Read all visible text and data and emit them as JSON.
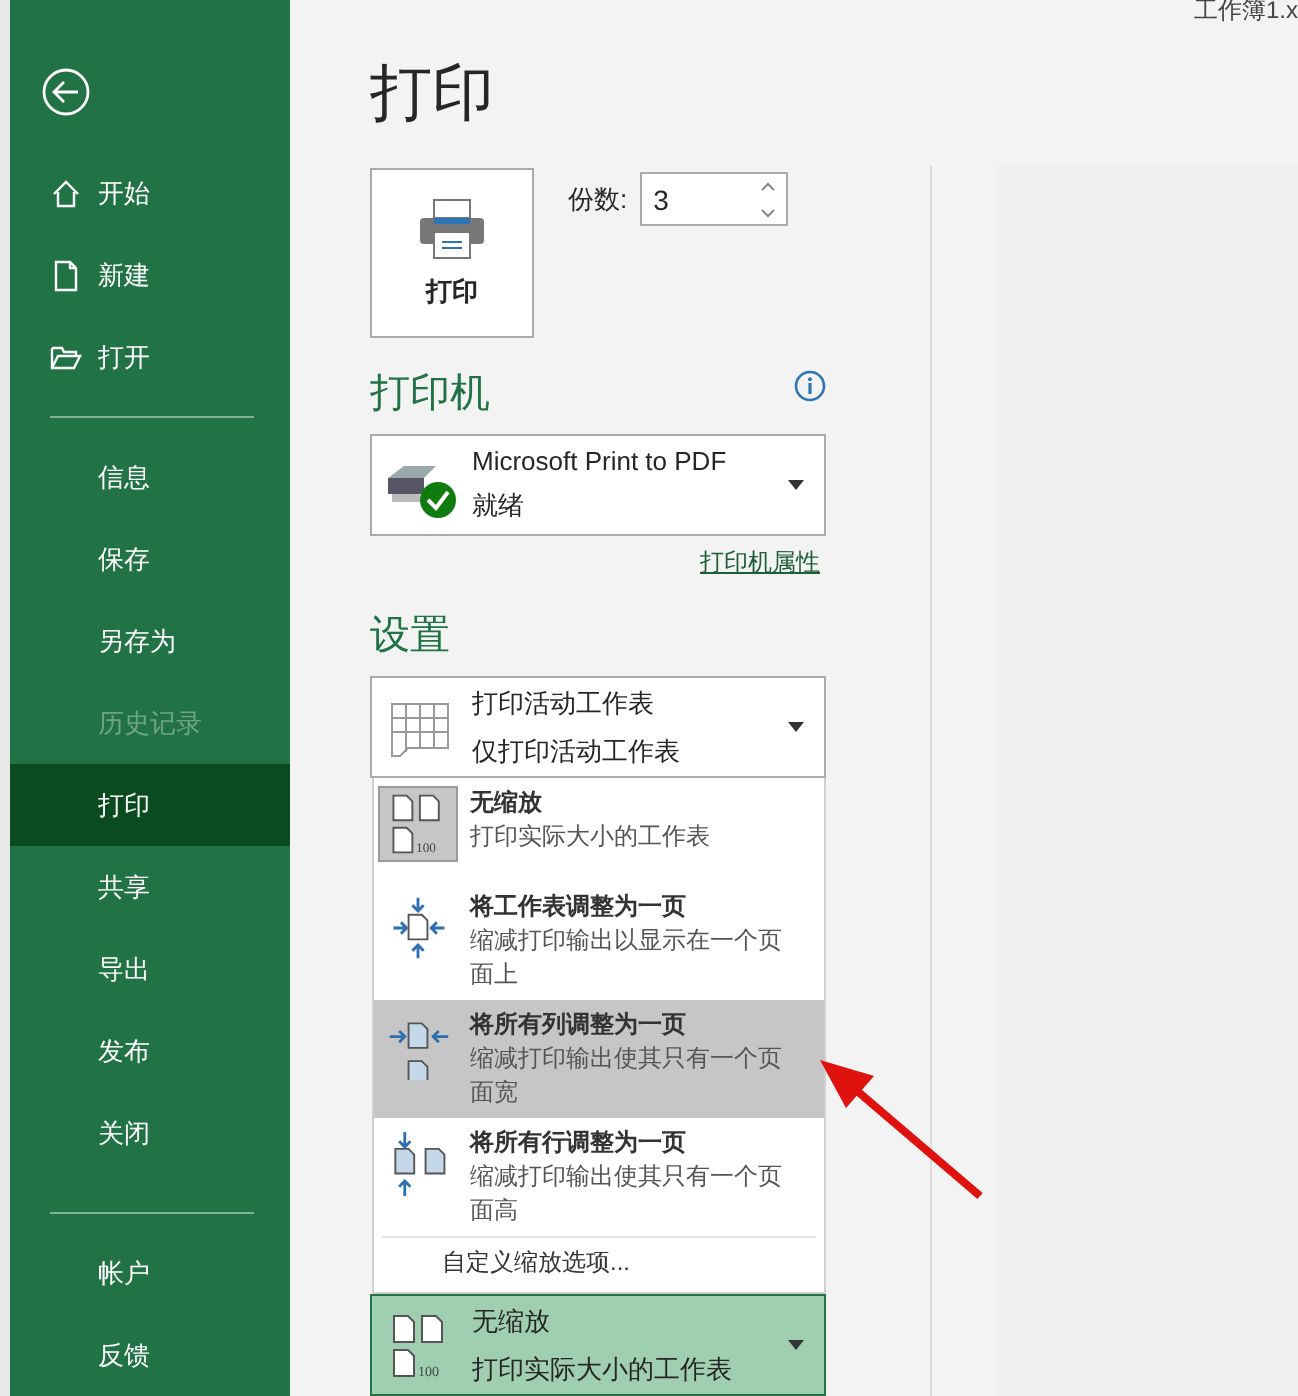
{
  "window": {
    "title": "工作簿1.x"
  },
  "sidebar": {
    "groups": [
      [
        {
          "label": "开始",
          "selected": false,
          "disabled": false
        },
        {
          "label": "新建",
          "selected": false,
          "disabled": false
        },
        {
          "label": "打开",
          "selected": false,
          "disabled": false
        }
      ],
      [
        {
          "label": "信息",
          "selected": false,
          "disabled": false
        },
        {
          "label": "保存",
          "selected": false,
          "disabled": false
        },
        {
          "label": "另存为",
          "selected": false,
          "disabled": false
        },
        {
          "label": "历史记录",
          "selected": false,
          "disabled": true
        },
        {
          "label": "打印",
          "selected": true,
          "disabled": false
        },
        {
          "label": "共享",
          "selected": false,
          "disabled": false
        },
        {
          "label": "导出",
          "selected": false,
          "disabled": false
        },
        {
          "label": "发布",
          "selected": false,
          "disabled": false
        },
        {
          "label": "关闭",
          "selected": false,
          "disabled": false
        }
      ],
      [
        {
          "label": "帐户",
          "selected": false,
          "disabled": false
        },
        {
          "label": "反馈",
          "selected": false,
          "disabled": false
        }
      ]
    ]
  },
  "page_title": "打印",
  "print_button": {
    "label": "打印"
  },
  "copies": {
    "label": "份数:",
    "value": "3"
  },
  "printer": {
    "heading": "打印机",
    "name": "Microsoft Print to PDF",
    "status": "就绪",
    "ready": true,
    "properties_link": "打印机属性"
  },
  "settings": {
    "heading": "设置",
    "dropdowns": [
      {
        "kind": "sheet",
        "title": "打印活动工作表",
        "subtitle": "仅打印活动工作表",
        "open": false
      },
      {
        "kind": "no-scaling",
        "icon_text": "100",
        "title": "无缩放",
        "subtitle": "打印实际大小的工作表",
        "open": true
      }
    ],
    "scaling_menu": {
      "items": [
        {
          "kind": "no-scaling",
          "icon_text": "100",
          "title": "无缩放",
          "description": "打印实际大小的工作表",
          "selected": true,
          "highlighted": false
        },
        {
          "kind": "fit-sheet",
          "title": "将工作表调整为一页",
          "description": "缩减打印输出以显示在一个页面上",
          "selected": false,
          "highlighted": false
        },
        {
          "kind": "fit-columns",
          "title": "将所有列调整为一页",
          "description": "缩减打印输出使其只有一个页面宽",
          "selected": false,
          "highlighted": true
        },
        {
          "kind": "fit-rows",
          "title": "将所有行调整为一页",
          "description": "缩减打印输出使其只有一个页面高",
          "selected": false,
          "highlighted": false
        }
      ],
      "footer": "自定义缩放选项..."
    }
  }
}
